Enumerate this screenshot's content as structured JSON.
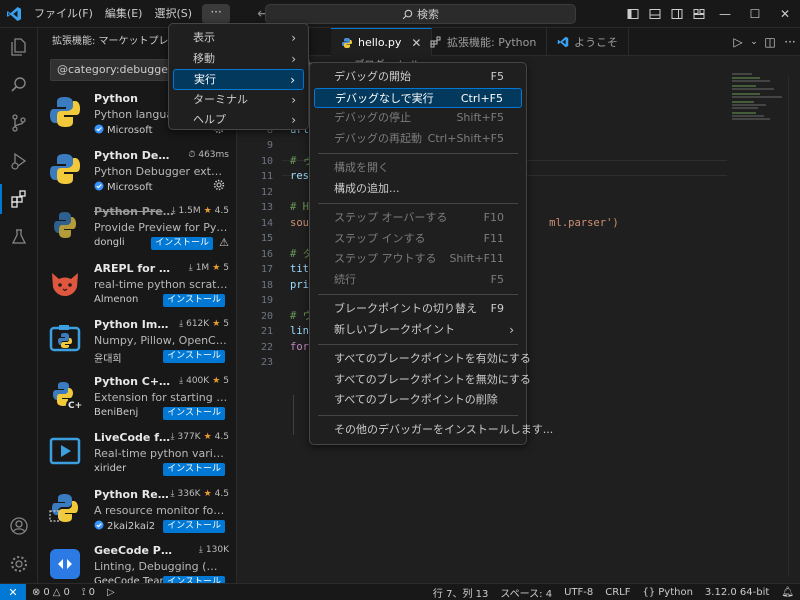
{
  "titlebar": {
    "menus": [
      "ファイル(F)",
      "編集(E)",
      "選択(S)"
    ],
    "more": "···",
    "search_placeholder": "検索",
    "window_controls": [
      "minimize",
      "maximize",
      "close"
    ]
  },
  "activity_bar": [
    "explorer-icon",
    "search-icon",
    "source-control-icon",
    "run-debug-icon",
    "extensions-icon",
    "testing-icon",
    "account-icon",
    "manage-gear-icon"
  ],
  "sidebar": {
    "title": "拡張機能: マーケットプレース",
    "search_value": "@category:debuggers Python",
    "extensions": [
      {
        "name": "Python",
        "meta_primary": "",
        "meta_secondary": "",
        "description": "Python language support",
        "publisher": "Microsoft",
        "verified": true,
        "action": "gear"
      },
      {
        "name": "Python Debugger",
        "meta_primary": "463ms",
        "meta_secondary": "",
        "description": "Python Debugger extension",
        "publisher": "Microsoft",
        "verified": true,
        "action": "gear"
      },
      {
        "name": "Python Preview",
        "meta_primary": "1.5M",
        "meta_secondary": "4.5",
        "description": "Provide Preview for Python",
        "publisher": "dongli",
        "verified": false,
        "action": "install",
        "deprecated": true
      },
      {
        "name": "AREPL for python",
        "meta_primary": "1M",
        "meta_secondary": "5",
        "description": "real-time python scratchpad",
        "publisher": "Almenon",
        "verified": false,
        "action": "install"
      },
      {
        "name": "Python Image Preview",
        "meta_primary": "612K",
        "meta_secondary": "5",
        "description": "Numpy, Pillow, OpenCV, Matplotlib",
        "publisher": "윤대희",
        "verified": false,
        "action": "install"
      },
      {
        "name": "Python C++ Debugger",
        "meta_primary": "400K",
        "meta_secondary": "5",
        "description": "Extension for starting the Python",
        "publisher": "BeniBenj",
        "verified": false,
        "action": "install"
      },
      {
        "name": "LiveCode for python",
        "meta_primary": "377K",
        "meta_secondary": "4.5",
        "description": "Real-time python variable editor",
        "publisher": "xirider",
        "verified": false,
        "action": "install"
      },
      {
        "name": "Python Resource Monitor",
        "meta_primary": "336K",
        "meta_secondary": "4.5",
        "description": "A resource monitor for the Python",
        "publisher": "2kai2kai2",
        "verified": true,
        "action": "install"
      },
      {
        "name": "GeeCode Python",
        "meta_primary": "130K",
        "meta_secondary": "",
        "description": "Linting, Debugging (multi-threaded)",
        "publisher": "GeeCode Team",
        "verified": false,
        "action": "install"
      }
    ],
    "install_label": "インストール"
  },
  "editor": {
    "tabs": [
      {
        "label": "hello.py",
        "icon": "python-file-icon",
        "active": true
      },
      {
        "label": "拡張機能: Python",
        "icon": "extensions-icon",
        "active": false
      },
      {
        "label": "ようこそ",
        "icon": "vscode-icon",
        "active": false
      }
    ],
    "breadcrumb": "… > 〜Python … > ブログ > hello.py > …",
    "line_numbers": [
      "5",
      "6",
      "7",
      "8",
      "9",
      "10",
      "11",
      "12",
      "13",
      "14",
      "15",
      "16",
      "17",
      "18",
      "19",
      "20",
      "21",
      "22",
      "23"
    ],
    "current_line": "7",
    "code": [
      "fro",
      "",
      "# ウ",
      "url",
      "",
      "# ゥ",
      "res",
      "",
      "# H",
      "sou                                      ml.parser')",
      "",
      "# タ",
      "tit",
      "pri",
      "",
      "# ウ",
      "lin",
      "for",
      ""
    ]
  },
  "main_menu": {
    "items": [
      {
        "label": "表示",
        "has_submenu": true
      },
      {
        "label": "移動",
        "has_submenu": true
      },
      {
        "label": "実行",
        "has_submenu": true,
        "selected": true
      },
      {
        "label": "ターミナル",
        "has_submenu": true
      },
      {
        "label": "ヘルプ",
        "has_submenu": true
      }
    ]
  },
  "run_menu": {
    "groups": [
      [
        {
          "label": "デバッグの開始",
          "shortcut": "F5",
          "enabled": true
        },
        {
          "label": "デバッグなしで実行",
          "shortcut": "Ctrl+F5",
          "enabled": true,
          "selected": true
        },
        {
          "label": "デバッグの停止",
          "shortcut": "Shift+F5",
          "enabled": false
        },
        {
          "label": "デバッグの再起動",
          "shortcut": "Ctrl+Shift+F5",
          "enabled": false
        }
      ],
      [
        {
          "label": "構成を開く",
          "shortcut": "",
          "enabled": false
        },
        {
          "label": "構成の追加...",
          "shortcut": "",
          "enabled": true
        }
      ],
      [
        {
          "label": "ステップ オーバーする",
          "shortcut": "F10",
          "enabled": false
        },
        {
          "label": "ステップ インする",
          "shortcut": "F11",
          "enabled": false
        },
        {
          "label": "ステップ アウトする",
          "shortcut": "Shift+F11",
          "enabled": false
        },
        {
          "label": "続行",
          "shortcut": "F5",
          "enabled": false
        }
      ],
      [
        {
          "label": "ブレークポイントの切り替え",
          "shortcut": "F9",
          "enabled": true
        },
        {
          "label": "新しいブレークポイント",
          "shortcut": "",
          "enabled": true,
          "has_submenu": true
        }
      ],
      [
        {
          "label": "すべてのブレークポイントを有効にする",
          "shortcut": "",
          "enabled": true
        },
        {
          "label": "すべてのブレークポイントを無効にする",
          "shortcut": "",
          "enabled": true
        },
        {
          "label": "すべてのブレークポイントの削除",
          "shortcut": "",
          "enabled": true
        }
      ],
      [
        {
          "label": "その他のデバッガーをインストールします...",
          "shortcut": "",
          "enabled": true
        }
      ]
    ]
  },
  "statusbar": {
    "errors": "0",
    "warnings": "0",
    "ports": "0",
    "position": "行 7、列 13",
    "spaces": "スペース: 4",
    "encoding": "UTF-8",
    "eol": "CRLF",
    "language": "Python",
    "interpreter": "3.12.0 64-bit"
  },
  "colors": {
    "accent": "#0078d4",
    "menu_selected_bg": "#04395e",
    "star": "#e89a2d"
  }
}
